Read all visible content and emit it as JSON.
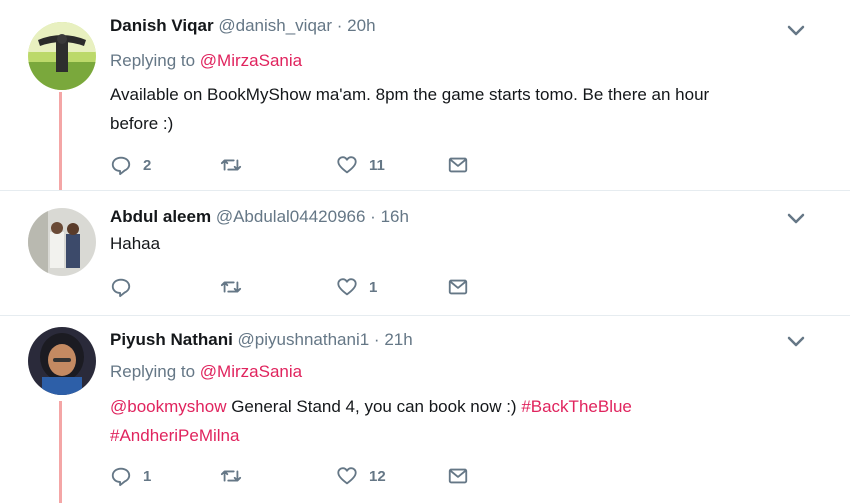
{
  "tweets": [
    {
      "name": "Danish Viqar",
      "handle": "@danish_viqar",
      "dot": "·",
      "time": "20h",
      "replying_prefix": "Replying to",
      "replying_to": "@MirzaSania",
      "text_line1": "Available on BookMyShow ma'am. 8pm the game starts tomo. Be there an hour",
      "text_line2": "before :)",
      "replies": "2",
      "retweets": "",
      "likes": "11"
    },
    {
      "name": "Abdul aleem",
      "handle": "@Abdulal04420966",
      "dot": "·",
      "time": "16h",
      "text": "Hahaa",
      "replies": "",
      "retweets": "",
      "likes": "1"
    },
    {
      "name": "Piyush Nathani",
      "handle": "@piyushnathani1",
      "dot": "·",
      "time": "21h",
      "replying_prefix": "Replying to",
      "replying_to": "@MirzaSania",
      "mention": "@bookmyshow",
      "text_middle": " General Stand 4, you can book now :) ",
      "hashtag1": "#BackTheBlue",
      "hashtag2": "#AndheriPeMilna",
      "replies": "1",
      "retweets": "",
      "likes": "12"
    }
  ],
  "icons": {
    "reply": "reply-icon",
    "retweet": "retweet-icon",
    "like": "heart-icon",
    "dm": "envelope-icon",
    "menu": "chevron-down-icon"
  },
  "colors": {
    "link": "#e0245e",
    "muted": "#657786",
    "thread_line": "#f4a6a6",
    "separator": "#e6ecf0"
  }
}
